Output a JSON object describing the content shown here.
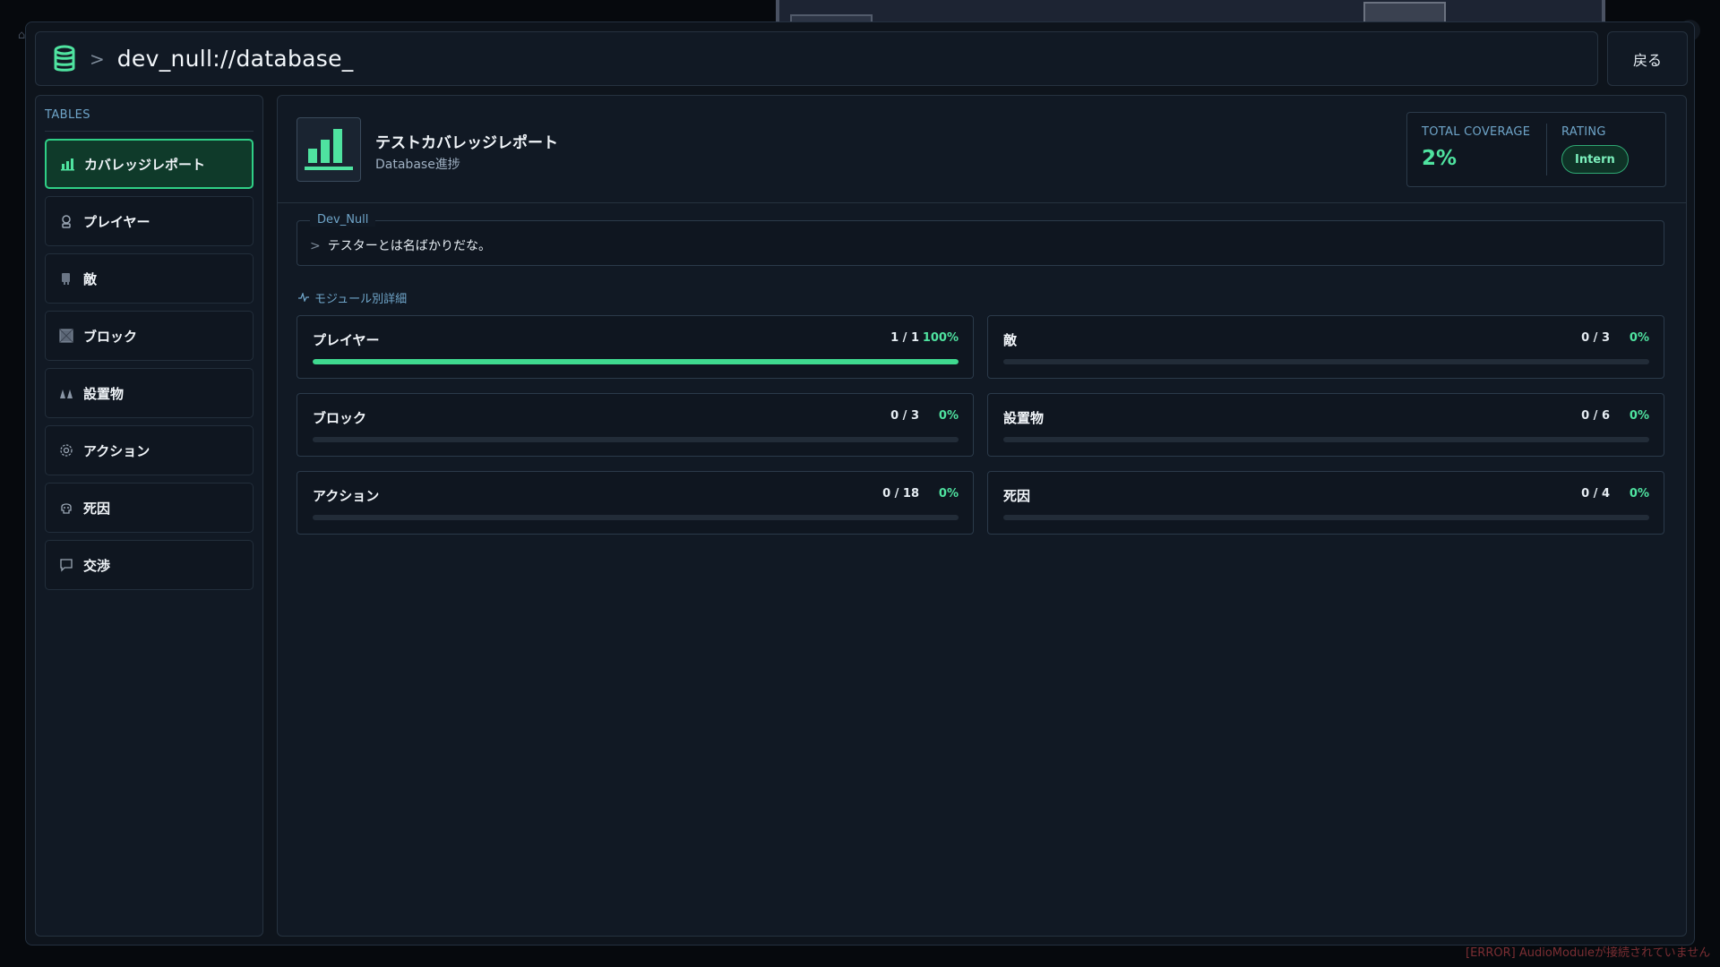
{
  "window": {
    "path": "dev_null://database_",
    "back_label": "戻る"
  },
  "sidebar": {
    "heading": "TABLES",
    "items": [
      {
        "label": "カバレッジレポート",
        "icon": "bar-chart-icon",
        "active": true
      },
      {
        "label": "プレイヤー",
        "icon": "player-icon",
        "active": false
      },
      {
        "label": "敵",
        "icon": "enemy-icon",
        "active": false
      },
      {
        "label": "ブロック",
        "icon": "block-icon",
        "active": false
      },
      {
        "label": "設置物",
        "icon": "object-icon",
        "active": false
      },
      {
        "label": "アクション",
        "icon": "gear-icon",
        "active": false
      },
      {
        "label": "死因",
        "icon": "skull-icon",
        "active": false
      },
      {
        "label": "交渉",
        "icon": "chat-icon",
        "active": false
      }
    ]
  },
  "report": {
    "title": "テストカバレッジレポート",
    "subtitle": "Database進捗",
    "coverage_label": "TOTAL COVERAGE",
    "coverage_value": "2%",
    "rating_label": "RATING",
    "rating_value": "Intern"
  },
  "quote": {
    "speaker": "Dev_Null",
    "text": "テスターとは名ばかりだな。"
  },
  "modules_label": "モジュール別詳細",
  "modules": [
    {
      "name": "プレイヤー",
      "count": "1 / 1",
      "percent": "100%",
      "progress": 1.0
    },
    {
      "name": "敵",
      "count": "0 / 3",
      "percent": "0%",
      "progress": 0
    },
    {
      "name": "ブロック",
      "count": "0 / 3",
      "percent": "0%",
      "progress": 0
    },
    {
      "name": "設置物",
      "count": "0 / 6",
      "percent": "0%",
      "progress": 0
    },
    {
      "name": "アクション",
      "count": "0 / 18",
      "percent": "0%",
      "progress": 0
    },
    {
      "name": "死因",
      "count": "0 / 4",
      "percent": "0%",
      "progress": 0
    }
  ],
  "status": {
    "error": "[ERROR] AudioModuleが接続されていません"
  },
  "colors": {
    "accent": "#3fd98f",
    "error": "#7a2e33"
  }
}
